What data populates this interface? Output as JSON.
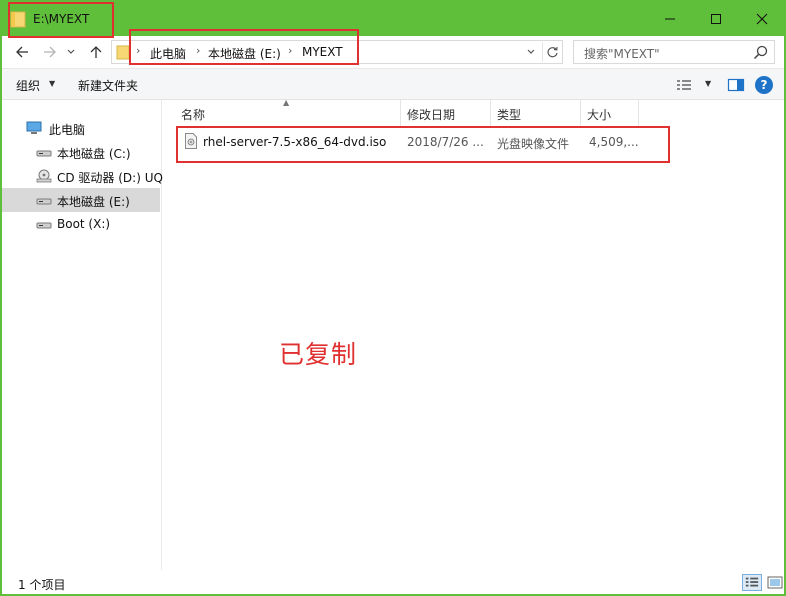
{
  "window": {
    "title": "E:\\MYEXT",
    "accent_color": "#5fbe3a"
  },
  "titlebar": {
    "minimize_icon": "minimize-icon",
    "maximize_icon": "maximize-icon",
    "close_icon": "close-icon"
  },
  "address": {
    "crumbs": [
      "此电脑",
      "本地磁盘 (E:)",
      "MYEXT"
    ],
    "search_placeholder": "搜索\"MYEXT\""
  },
  "toolbar": {
    "organize_label": "组织",
    "new_folder_label": "新建文件夹"
  },
  "navpane": {
    "items": [
      {
        "label": "此电脑",
        "icon": "computer-icon",
        "selected": false
      },
      {
        "label": "本地磁盘 (C:)",
        "icon": "drive-icon",
        "selected": false
      },
      {
        "label": "CD 驱动器 (D:) UQ",
        "icon": "cd-drive-icon",
        "selected": false
      },
      {
        "label": "本地磁盘 (E:)",
        "icon": "drive-icon",
        "selected": true
      },
      {
        "label": "Boot (X:)",
        "icon": "drive-icon",
        "selected": false
      }
    ]
  },
  "columns": {
    "name": "名称",
    "date": "修改日期",
    "type": "类型",
    "size": "大小"
  },
  "files": [
    {
      "name": "rhel-server-7.5-x86_64-dvd.iso",
      "date": "2018/7/26 ...",
      "type": "光盘映像文件",
      "size": "4,509,..."
    }
  ],
  "annotation": {
    "text": "已复制",
    "color": "#e03030"
  },
  "status": {
    "item_count": "1 个项目"
  }
}
